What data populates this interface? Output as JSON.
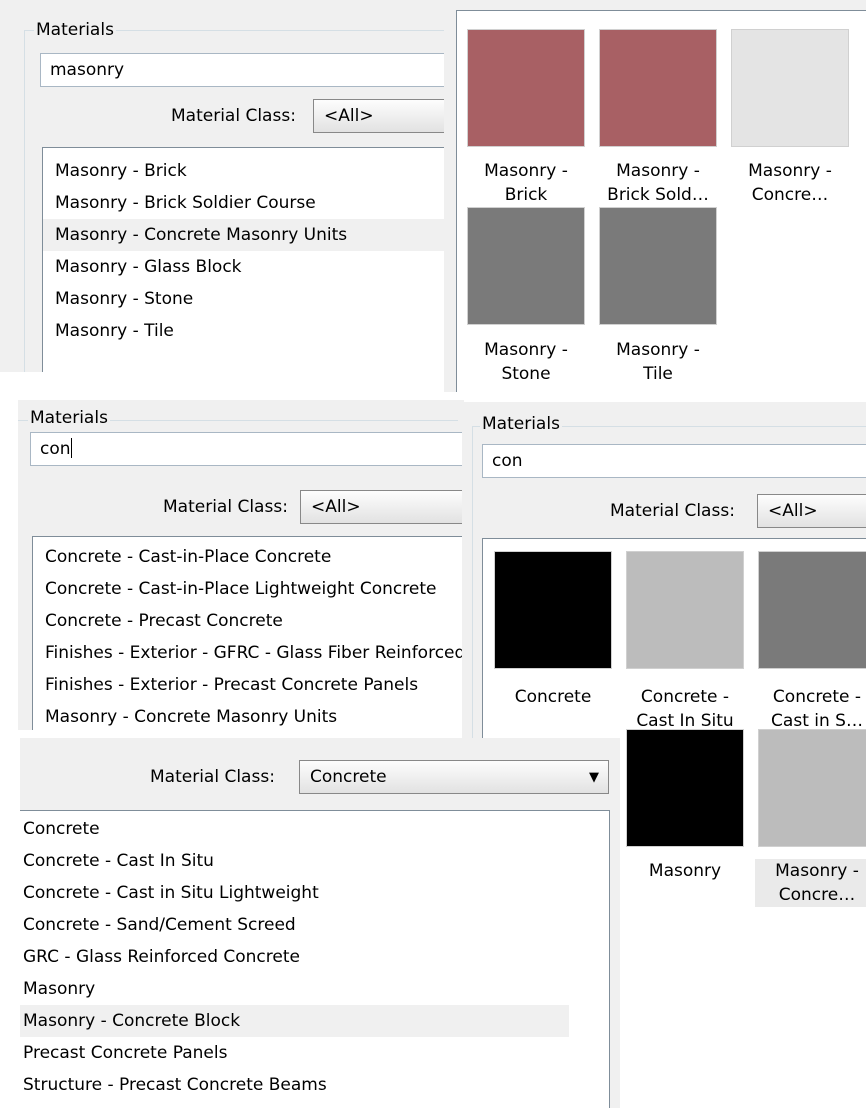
{
  "colors": {
    "brick": "#a86064",
    "light_gray": "#e4e4e4",
    "gray": "#7a7a7a",
    "black": "#000000",
    "pale_gray": "#bcbcbc"
  },
  "panel1": {
    "group_label": "Materials",
    "search_value": "masonry",
    "class_label": "Material Class:",
    "class_value": "<All>",
    "items": [
      "Masonry - Brick",
      "Masonry - Brick Soldier Course",
      "Masonry - Concrete Masonry Units",
      "Masonry - Glass Block",
      "Masonry - Stone",
      "Masonry - Tile"
    ]
  },
  "panel2": {
    "tiles": [
      {
        "line1": "Masonry -",
        "line2": "Brick"
      },
      {
        "line1": "Masonry -",
        "line2": "Brick Sold…"
      },
      {
        "line1": "Masonry -",
        "line2": "Concre…"
      },
      {
        "line1": "Masonry -",
        "line2": "Stone"
      },
      {
        "line1": "Masonry -",
        "line2": "Tile"
      }
    ]
  },
  "panel3": {
    "group_label": "Materials",
    "search_value": "con",
    "class_label": "Material Class:",
    "class_value": "<All>",
    "items": [
      "Concrete - Cast-in-Place Concrete",
      "Concrete - Cast-in-Place Lightweight Concrete",
      "Concrete - Precast Concrete",
      "Finishes - Exterior - GFRC -  Glass Fiber Reinforced Concrete",
      "Finishes - Exterior - Precast Concrete Panels",
      "Masonry - Concrete Masonry Units"
    ]
  },
  "panel4": {
    "group_label": "Materials",
    "search_value": "con",
    "class_label": "Material Class:",
    "class_value": "<All>",
    "tiles": [
      {
        "line1": "Concrete",
        "line2": ""
      },
      {
        "line1": "Concrete -",
        "line2": "Cast In Situ"
      },
      {
        "line1": "Concrete -",
        "line2": "Cast in S…"
      },
      {
        "line1": "Masonry",
        "line2": ""
      },
      {
        "line1": "Masonry -",
        "line2": "Concre…"
      }
    ]
  },
  "panel5": {
    "class_label": "Material Class:",
    "class_value": "Concrete",
    "items": [
      "Concrete",
      "Concrete - Cast In Situ",
      "Concrete - Cast in Situ Lightweight",
      "Concrete - Sand/Cement Screed",
      "GRC -  Glass Reinforced Concrete",
      "Masonry",
      "Masonry - Concrete Block",
      "Precast Concrete Panels",
      "Structure - Precast Concrete Beams"
    ]
  }
}
